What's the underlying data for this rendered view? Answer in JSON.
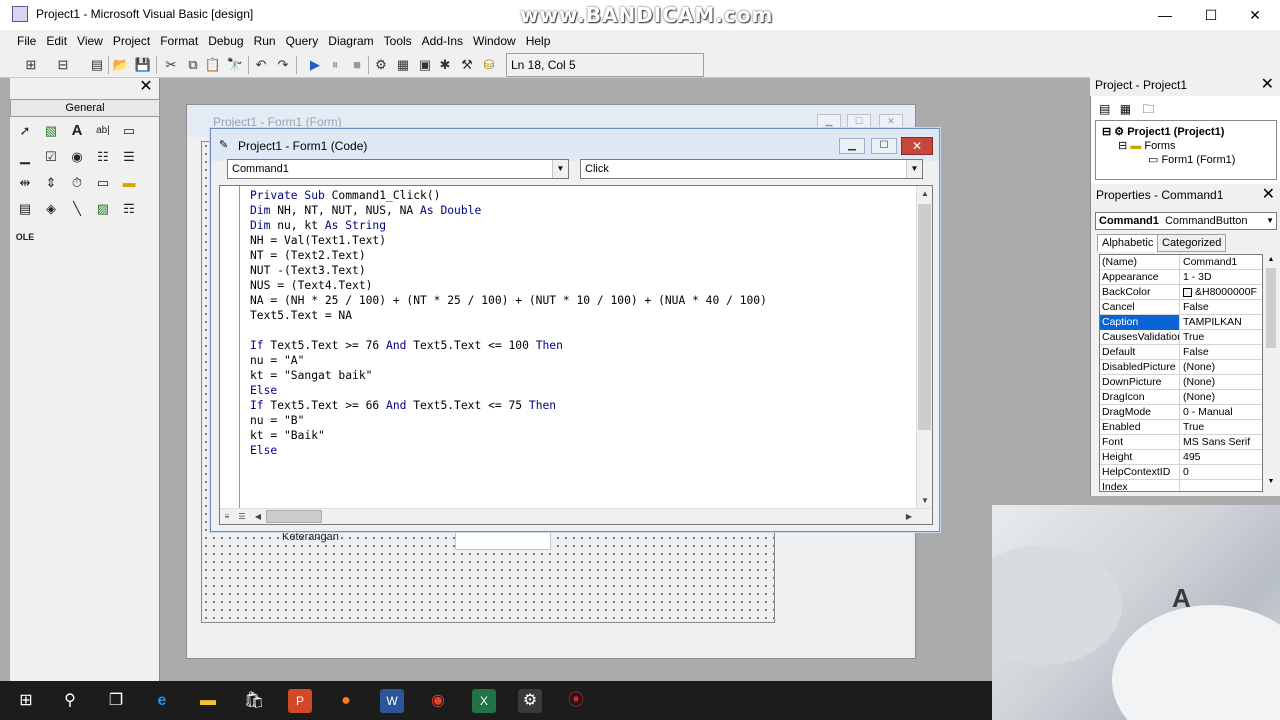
{
  "window": {
    "title": "Project1 - Microsoft Visual Basic [design]",
    "minimize": "—",
    "maximize": "☐",
    "close": "✕"
  },
  "watermark": "www.BANDICAM.com",
  "menu": [
    "File",
    "Edit",
    "View",
    "Project",
    "Format",
    "Debug",
    "Run",
    "Query",
    "Diagram",
    "Tools",
    "Add-Ins",
    "Window",
    "Help"
  ],
  "toolbar": {
    "status": "Ln 18, Col 5"
  },
  "toolbox": {
    "tab": "General",
    "close": "✕"
  },
  "form_window": {
    "title": "Project1 - Form1 (Form)",
    "label_keterangan": "Keterangan"
  },
  "code_window": {
    "title": "Project1 - Form1 (Code)",
    "object_combo": "Command1",
    "procedure_combo": "Click",
    "code_lines": [
      "Private Sub Command1_Click()",
      "Dim NH, NT, NUT, NUS, NA As Double",
      "Dim nu, kt As String",
      "NH = Val(Text1.Text)",
      "NT = (Text2.Text)",
      "NUT -(Text3.Text)",
      "NUS = (Text4.Text)",
      "NA = (NH * 25 / 100) + (NT * 25 / 100) + (NUT * 10 / 100) + (NUA * 40 / 100)",
      "Text5.Text = NA",
      "",
      "If Text5.Text >= 76 And Text5.Text <= 100 Then",
      "nu = \"A\"",
      "kt = \"Sangat baik\"",
      "Else",
      "If Text5.Text >= 66 And Text5.Text <= 75 Then",
      "nu = \"B\"",
      "kt = \"Baik\"",
      "Else"
    ]
  },
  "project_panel": {
    "title": "Project - Project1",
    "close": "✕",
    "root": "Project1 (Project1)",
    "folder": "Forms",
    "form": "Form1 (Form1)"
  },
  "properties_panel": {
    "title": "Properties - Command1",
    "close": "✕",
    "object": "Command1",
    "object_type": "CommandButton",
    "tabs": [
      "Alphabetic",
      "Categorized"
    ],
    "rows": [
      {
        "name": "(Name)",
        "value": "Command1"
      },
      {
        "name": "Appearance",
        "value": "1 - 3D"
      },
      {
        "name": "BackColor",
        "value": "&H8000000F"
      },
      {
        "name": "Cancel",
        "value": "False"
      },
      {
        "name": "Caption",
        "value": "TAMPILKAN"
      },
      {
        "name": "CausesValidation",
        "value": "True"
      },
      {
        "name": "Default",
        "value": "False"
      },
      {
        "name": "DisabledPicture",
        "value": "(None)"
      },
      {
        "name": "DownPicture",
        "value": "(None)"
      },
      {
        "name": "DragIcon",
        "value": "(None)"
      },
      {
        "name": "DragMode",
        "value": "0 - Manual"
      },
      {
        "name": "Enabled",
        "value": "True"
      },
      {
        "name": "Font",
        "value": "MS Sans Serif"
      },
      {
        "name": "Height",
        "value": "495"
      },
      {
        "name": "HelpContextID",
        "value": "0"
      },
      {
        "name": "Index",
        "value": ""
      }
    ],
    "selected_row": "Caption"
  }
}
